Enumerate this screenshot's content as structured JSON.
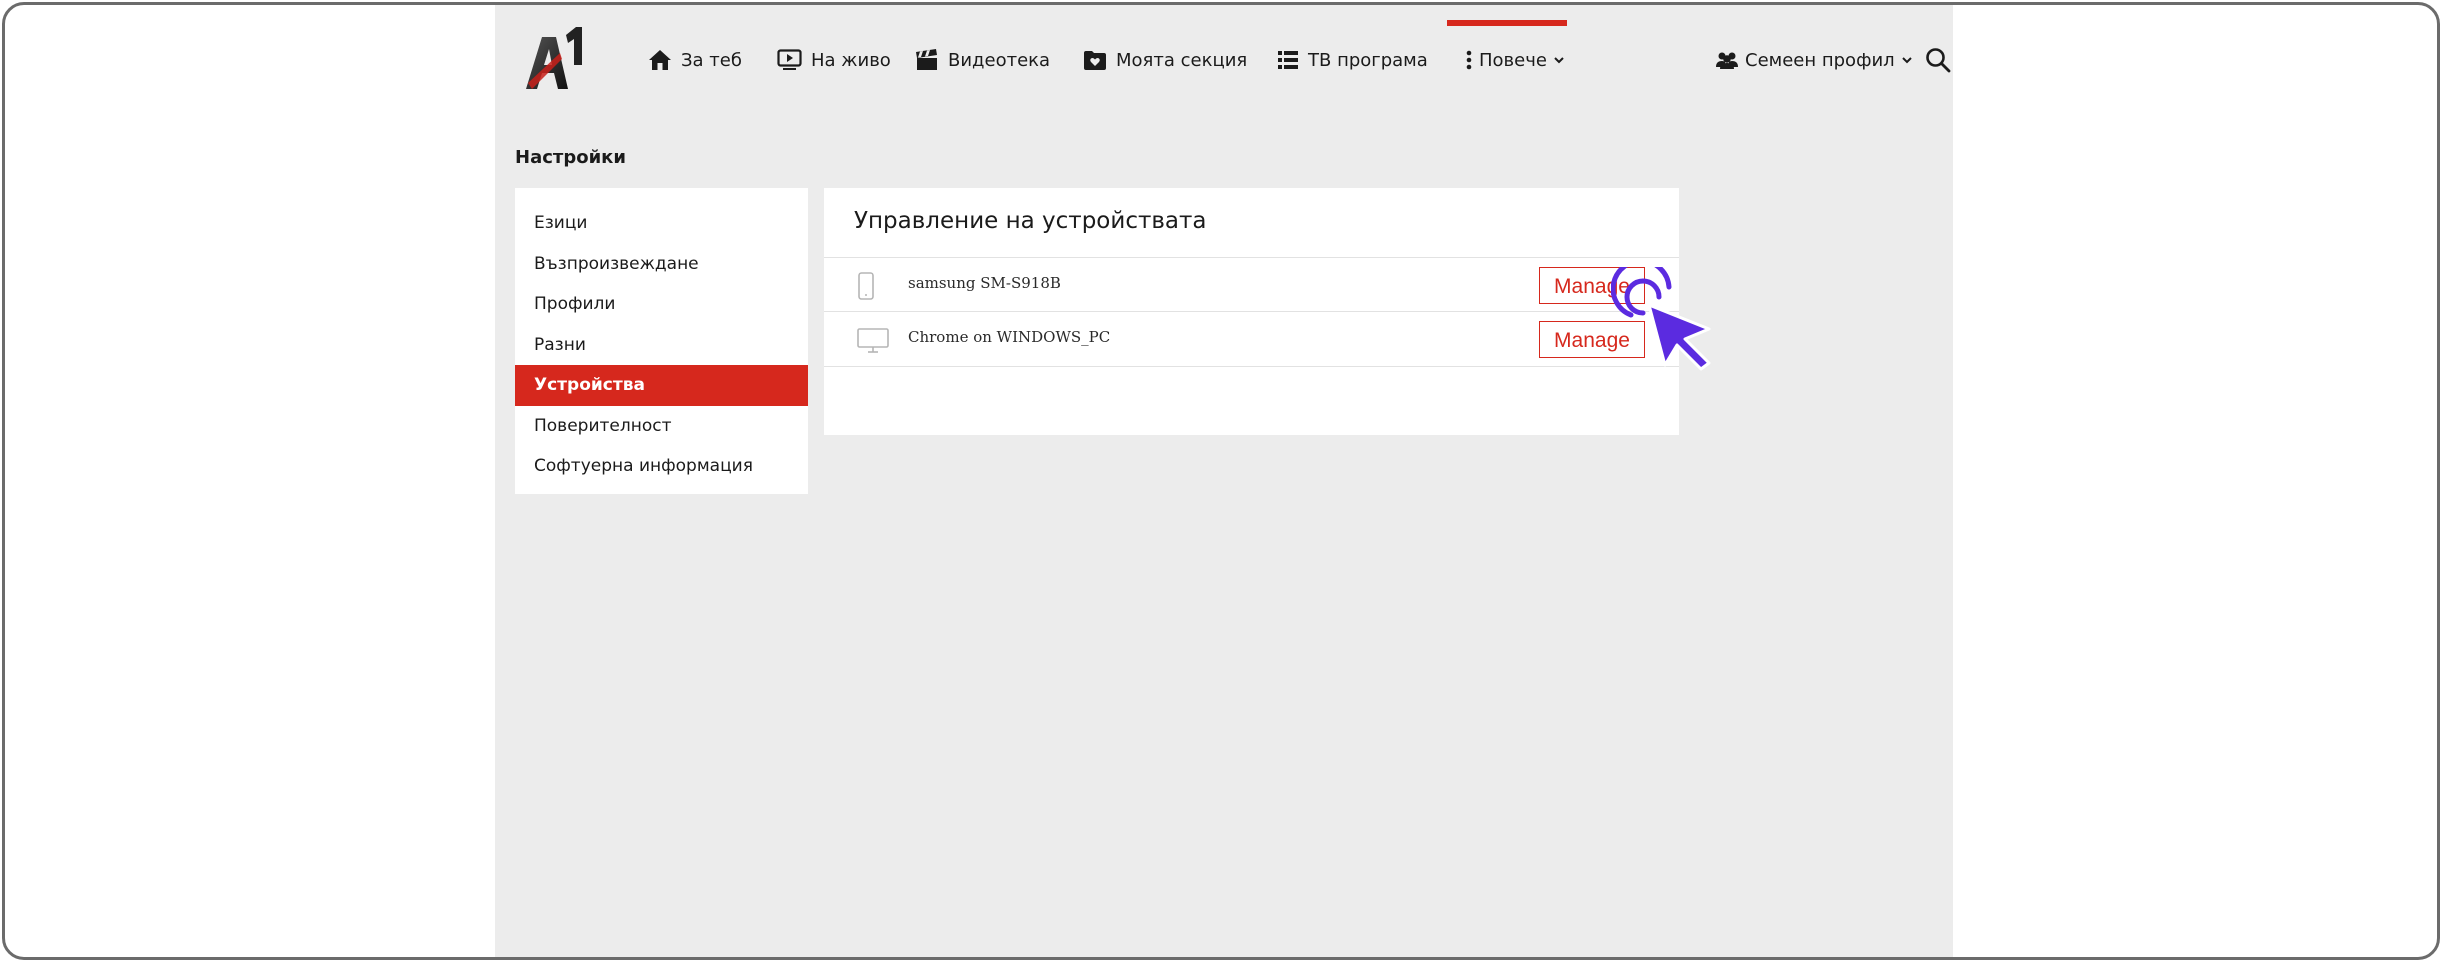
{
  "nav": {
    "items": [
      {
        "label": "За теб",
        "icon": "home-icon"
      },
      {
        "label": "На живо",
        "icon": "live-tv-icon"
      },
      {
        "label": "Видеотека",
        "icon": "clapperboard-icon"
      },
      {
        "label": "Моята секция",
        "icon": "favorites-folder-icon"
      },
      {
        "label": "ТВ програма",
        "icon": "list-icon"
      },
      {
        "label": "Повече",
        "icon": "more-vertical-icon",
        "active": true
      }
    ],
    "profile_label": "Семеен профил",
    "profile_icon": "users-icon",
    "search_icon": "search-icon"
  },
  "page": {
    "title": "Настройки"
  },
  "sidebar": {
    "items": [
      {
        "label": "Езици"
      },
      {
        "label": "Възпроизвеждане"
      },
      {
        "label": "Профили"
      },
      {
        "label": "Разни"
      },
      {
        "label": "Устройства",
        "active": true
      },
      {
        "label": "Поверителност"
      },
      {
        "label": "Софтуерна информация"
      }
    ]
  },
  "panel": {
    "title": "Управление на устройствата",
    "devices": [
      {
        "name": "samsung SM-S918B",
        "icon": "phone-icon",
        "button": "Manage"
      },
      {
        "name": "Chrome on WINDOWS_PC",
        "icon": "monitor-icon",
        "button": "Manage"
      }
    ]
  },
  "colors": {
    "accent": "#d6281d",
    "background": "#ececec",
    "cursor": "#5b2be0"
  }
}
